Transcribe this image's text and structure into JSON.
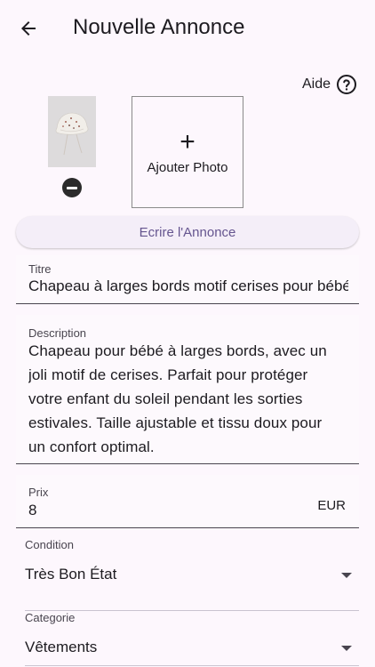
{
  "appbar": {
    "title": "Nouvelle Annonce"
  },
  "help": {
    "label": "Aide"
  },
  "photos": {
    "add_label": "Ajouter Photo"
  },
  "write_button": {
    "label": "Ecrire l'Annonce"
  },
  "form": {
    "titre": {
      "label": "Titre",
      "value": "Chapeau à larges bords motif cerises pour bébé"
    },
    "description": {
      "label": "Description",
      "value": "Chapeau pour bébé à larges bords, avec un joli motif de cerises. Parfait pour protéger votre enfant du soleil pendant les sorties estivales. Taille ajustable et tissu doux pour un confort optimal."
    },
    "prix": {
      "label": "Prix",
      "value": "8",
      "suffix": "EUR"
    },
    "condition": {
      "label": "Condition",
      "value": "Très Bon État"
    },
    "categorie": {
      "label": "Categorie",
      "value": "Vêtements"
    }
  },
  "colors": {
    "accent": "#65558f",
    "background": "#fdf7fd",
    "button_bg": "#f4eef8"
  }
}
